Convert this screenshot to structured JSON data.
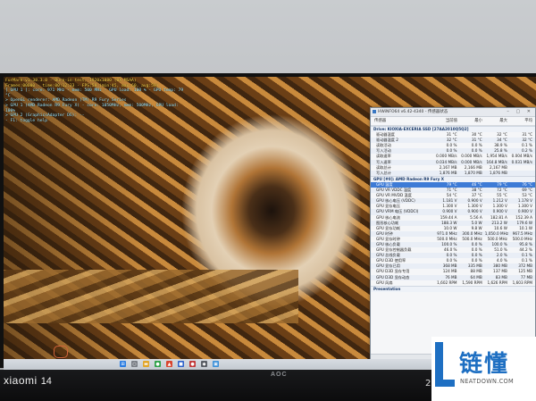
{
  "osd": {
    "lines": [
      "FurMark v1.38.3.0 - Burn-in test, 1920x1080 (0X MSAA)",
      "Frames:00000 - time:00:12:33 - FPS:59 (min:45, max:60, avg:58)",
      "[ GPU 1 ]: core: 971 MHz - mem: 500 MHz - GPU load: 100 % - GPU temp: 79 °C",
      "> OpenGL renderer: AMD Radeon (TM) R9 Fury Series",
      "> GPU 1 (AMD Radeon R9 Fury X) - core: 1050MHz, mem: 500MHz, GPU load: 100%",
      "> GPU 2 (GraphicsAdapter DG): --",
      "- F1: toggle help"
    ]
  },
  "hwinfo": {
    "title": "HWiNFO64 v6.42-4340 - 传感器状态",
    "columns": [
      "传感器",
      "当前值",
      "最小",
      "最大",
      "平均"
    ],
    "groups": [
      {
        "name": "Drive: KIOXIA-EXCERIA SSD [27AA2010Q5Q2]",
        "rows": [
          [
            "驱动器温度",
            "31 °C",
            "30 °C",
            "32 °C",
            "31 °C"
          ],
          [
            "驱动器温度 2",
            "32 °C",
            "31 °C",
            "34 °C",
            "32 °C"
          ],
          [
            "读取活动",
            "0.0 %",
            "0.0 %",
            "38.9 %",
            "0.1 %"
          ],
          [
            "写入活动",
            "0.0 %",
            "0.0 %",
            "25.8 %",
            "0.2 %"
          ],
          [
            "读取速率",
            "0.000 MB/s",
            "0.000 MB/s",
            "1,954 MB/s",
            "0.004 MB/s"
          ],
          [
            "写入速率",
            "0.034 MB/s",
            "0.000 MB/s",
            "164.8 MB/s",
            "0.031 MB/s"
          ],
          [
            "读取总计",
            "2,167 MB",
            "2,166 MB",
            "2,167 MB",
            ""
          ],
          [
            "写入总计",
            "1,876 MB",
            "1,870 MB",
            "1,876 MB",
            ""
          ]
        ]
      },
      {
        "name": "GPU [#0]: AMD Radeon R9 Fury X",
        "rows": [
          [
            "GPU 温度",
            "79 °C",
            "46 °C",
            "79 °C",
            "76 °C"
          ],
          [
            "GPU VR VDDC 温度",
            "71 °C",
            "38 °C",
            "72 °C",
            "69 °C"
          ],
          [
            "GPU VR MVDD 温度",
            "54 °C",
            "37 °C",
            "55 °C",
            "53 °C"
          ],
          [
            "GPU 核心电压 (VDDC)",
            "1.181 V",
            "0.900 V",
            "1.212 V",
            "1.178 V"
          ],
          [
            "GPU 显存电压",
            "1.300 V",
            "1.300 V",
            "1.300 V",
            "1.300 V"
          ],
          [
            "GPU VRM 电压 (VDDCI)",
            "0.900 V",
            "0.900 V",
            "0.900 V",
            "0.900 V"
          ],
          [
            "GPU 核心电流",
            "159.44 A",
            "5.56 A",
            "182.81 A",
            "152.39 A"
          ],
          [
            "图形核心功耗",
            "188.3 W",
            "5.0 W",
            "213.2 W",
            "179.6 W"
          ],
          [
            "GPU 显存功耗",
            "10.0 W",
            "9.8 W",
            "10.6 W",
            "10.1 W"
          ],
          [
            "GPU 时钟",
            "971.0 MHz",
            "300.0 MHz",
            "1,050.0 MHz",
            "967.5 MHz"
          ],
          [
            "GPU 显存时钟",
            "500.0 MHz",
            "500.0 MHz",
            "500.0 MHz",
            "500.0 MHz"
          ],
          [
            "GPU 核心负载",
            "100.0 %",
            "0.0 %",
            "100.0 %",
            "95.8 %"
          ],
          [
            "GPU 显存控制器负载",
            "46.0 %",
            "0.0 %",
            "51.0 %",
            "44.2 %"
          ],
          [
            "GPU 总线负载",
            "0.0 %",
            "0.0 %",
            "2.0 %",
            "0.1 %"
          ],
          [
            "GPU D3D 使用率",
            "0.0 %",
            "0.0 %",
            "4.0 %",
            "0.1 %"
          ],
          [
            "GPU 显存已用",
            "368 MB",
            "335 MB",
            "380 MB",
            "372 MB"
          ],
          [
            "GPU D3D 显存专用",
            "124 MB",
            "88 MB",
            "137 MB",
            "125 MB"
          ],
          [
            "GPU D3D 显存动态",
            "76 MB",
            "64 MB",
            "83 MB",
            "77 MB"
          ],
          [
            "GPU 风扇",
            "1,602 RPM",
            "1,590 RPM",
            "1,626 RPM",
            "1,603 RPM"
          ]
        ]
      },
      {
        "name": "Presentation",
        "rows": []
      }
    ]
  },
  "monitor": {
    "brand": "AOC"
  },
  "camera_watermark": {
    "brand": "xiaomi",
    "model": "14"
  },
  "clock_partial": "2",
  "site_watermark": {
    "title": "链懂",
    "subtitle": "NEATDOWN.COM"
  },
  "colors": {
    "watermark_blue": "#1e6fc2",
    "selection": "#3d7bd6",
    "osd_yellow": "#ffd94a"
  }
}
